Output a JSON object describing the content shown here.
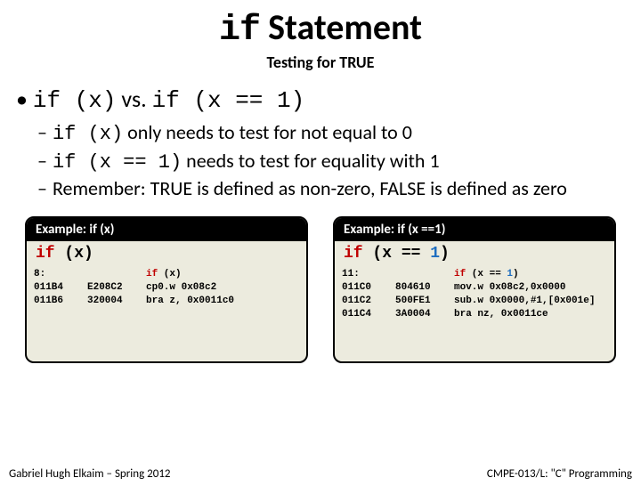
{
  "title": {
    "code": "if",
    "text": " Statement"
  },
  "subtitle": "Testing for TRUE",
  "main_bullet": {
    "dot": "•",
    "c1": "if (x)",
    "vs": " vs. ",
    "c2": "if (x == 1)"
  },
  "subs": [
    {
      "dash": "–",
      "code": "if (x)",
      "text": " only needs to test for not equal to 0"
    },
    {
      "dash": "–",
      "code": "if (x == 1)",
      "text": " needs to test for equality with 1"
    },
    {
      "dash": "–",
      "code": "",
      "text": "Remember: TRUE is defined as non-zero, FALSE is defined as zero"
    }
  ],
  "ex_left": {
    "header": "Example: if (x)",
    "top": {
      "kw": "if",
      "mid": " (x)"
    },
    "col1": "8:\n011B4\n011B6",
    "col2": "\nE208C2\n320004",
    "col3_pre": "if",
    "col3_rest": " (x)\ncp0.w 0x08c2\nbra z, 0x0011c0"
  },
  "ex_right": {
    "header": "Example: if (x ==1)",
    "top": {
      "kw": "if",
      "mid": " (x == ",
      "num": "1",
      "end": ")"
    },
    "col1": "11:\n011C0\n011C2\n011C4",
    "col2": "\n804610\n500FE1\n3A0004",
    "col3_pre": "if",
    "col3_mid": " (x == ",
    "col3_num": "1",
    "col3_rest": ")\nmov.w 0x08c2,0x0000\nsub.w 0x0000,#1,[0x001e]\nbra nz, 0x0011ce"
  },
  "footer": {
    "left": "Gabriel Hugh Elkaim – Spring 2012",
    "right": "CMPE-013/L: \"C\" Programming"
  }
}
